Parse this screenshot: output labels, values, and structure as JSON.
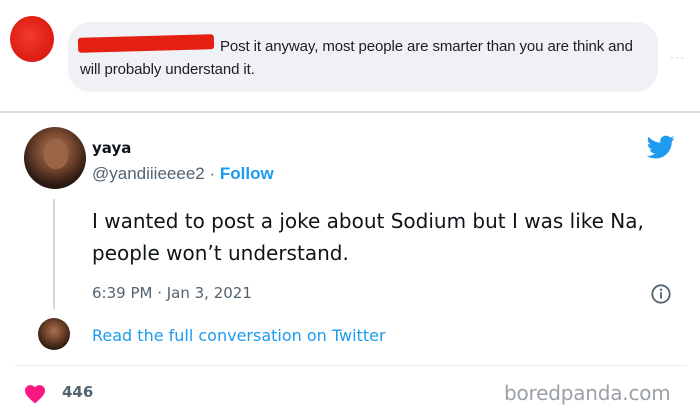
{
  "comment": {
    "text": "Post it anyway, most people are smarter than you are think and will probably understand it.",
    "more_icon": "ellipsis-icon",
    "avatar_color": "#e32012"
  },
  "tweet": {
    "author_name": "yaya",
    "handle": "@yandiiieeee2",
    "separator": "·",
    "follow_label": "Follow",
    "body": "I wanted to post a joke about Sodium but I was like Na, people won’t understand.",
    "timestamp": "6:39 PM · Jan 3, 2021",
    "read_conversation_label": "Read the full conversation on Twitter",
    "likes": "446",
    "icons": [
      "twitter-bird-icon",
      "info-icon",
      "heart-icon"
    ],
    "colors": {
      "accent": "#1d9bf0",
      "heart": "#f91880",
      "secondary_text": "#536471"
    }
  },
  "watermark": "boredpanda.com"
}
